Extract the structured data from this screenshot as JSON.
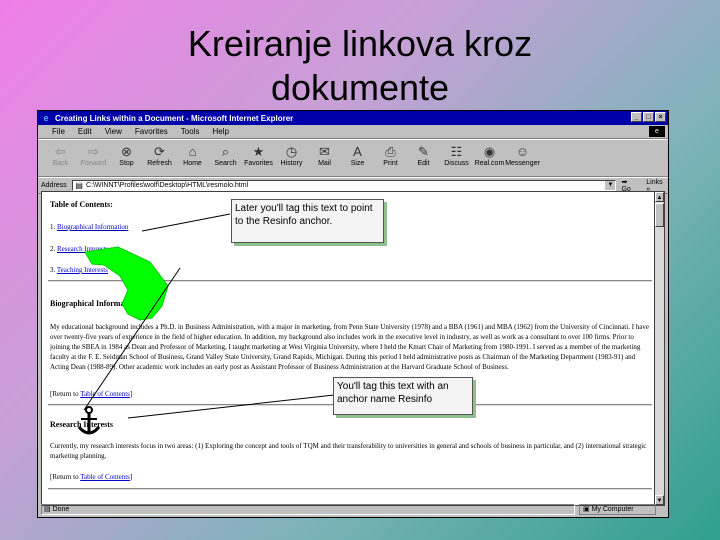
{
  "slide": {
    "title_line1": "Kreiranje linkova kroz",
    "title_line2": "dokumente"
  },
  "browser": {
    "window_title": "Creating Links within a Document - Microsoft Internet Explorer",
    "menu": [
      "File",
      "Edit",
      "View",
      "Favorites",
      "Tools",
      "Help"
    ],
    "toolbar": [
      {
        "label": "Back",
        "icon": "back-arrow-icon",
        "glyph": "⇦",
        "enabled": false
      },
      {
        "label": "Forward",
        "icon": "forward-arrow-icon",
        "glyph": "⇨",
        "enabled": false
      },
      {
        "label": "Stop",
        "icon": "stop-icon",
        "glyph": "⊗",
        "enabled": true
      },
      {
        "label": "Refresh",
        "icon": "refresh-icon",
        "glyph": "⟳",
        "enabled": true
      },
      {
        "label": "Home",
        "icon": "home-icon",
        "glyph": "⌂",
        "enabled": true
      },
      {
        "label": "Search",
        "icon": "search-icon",
        "glyph": "⌕",
        "enabled": true
      },
      {
        "label": "Favorites",
        "icon": "favorites-icon",
        "glyph": "★",
        "enabled": true
      },
      {
        "label": "History",
        "icon": "history-icon",
        "glyph": "◷",
        "enabled": true
      },
      {
        "label": "Mail",
        "icon": "mail-icon",
        "glyph": "✉",
        "enabled": true
      },
      {
        "label": "Size",
        "icon": "font-size-icon",
        "glyph": "A",
        "enabled": true
      },
      {
        "label": "Print",
        "icon": "print-icon",
        "glyph": "⎙",
        "enabled": true
      },
      {
        "label": "Edit",
        "icon": "edit-icon",
        "glyph": "✎",
        "enabled": true
      },
      {
        "label": "Discuss",
        "icon": "discuss-icon",
        "glyph": "☷",
        "enabled": true
      },
      {
        "label": "Real.com",
        "icon": "realcom-icon",
        "glyph": "◉",
        "enabled": true
      },
      {
        "label": "Messenger",
        "icon": "messenger-icon",
        "glyph": "☺",
        "enabled": true
      }
    ],
    "address_label": "Address",
    "address_value": "C:\\WINNT\\Profiles\\wolf\\Desktop\\HTML\\resmolo.html",
    "go_label": "Go",
    "links_label": "Links »",
    "status_text": "Done",
    "status_zone": "My Computer"
  },
  "page": {
    "toc_heading": "Table of Contents:",
    "toc_items": [
      {
        "num": "1.",
        "text": "Biographical Information"
      },
      {
        "num": "2.",
        "text": "Research Interests"
      },
      {
        "num": "3.",
        "text": "Teaching Interests"
      }
    ],
    "bio_heading": "Biographical Information",
    "bio_paragraph": "My educational background includes a Ph.D. in Business Administration, with a major in marketing, from Penn State University (1978) and a BBA (1961) and MBA (1962) from the University of Cincinnati. I have over twenty-five years of experience in the field of higher education. In addition, my background also includes work in the executive level in industry, as well as work as a consultant to over 100 firms. Prior to joining the SBEA in 1984 as Dean and Professor of Marketing, I taught marketing at West Virginia University, where I held the Kmart Chair of Marketing from 1980-1991. I served as a member of the marketing faculty at the F. E. Seidman School of Business, Grand Valley State University, Grand Rapids, Michigan. During this period I held administrative posts as Chairman of the Marketing Department (1983-91) and Acting Dean (1988-89). Other academic work includes an early post as Assistant Professor of Business Administration at the Harvard Graduate School of Business.",
    "return_prefix": "[Return to ",
    "return_link": "Table of Contents",
    "return_suffix": "]",
    "research_heading": "Research Interests",
    "research_paragraph": "Currently, my research interests focus in two areas: (1) Exploring the concept and tools of TQM and their transferability to universities in general and schools of business in particular, and (2) international strategic marketing planning."
  },
  "callouts": {
    "top": "Later you'll tag this text to point to the Resinfo anchor.",
    "bottom": "You'll tag this text with an anchor name Resinfo"
  },
  "colors": {
    "arrow_green": "#00ff00",
    "titlebar_blue": "#0000a8",
    "link_blue": "#0000cc"
  }
}
